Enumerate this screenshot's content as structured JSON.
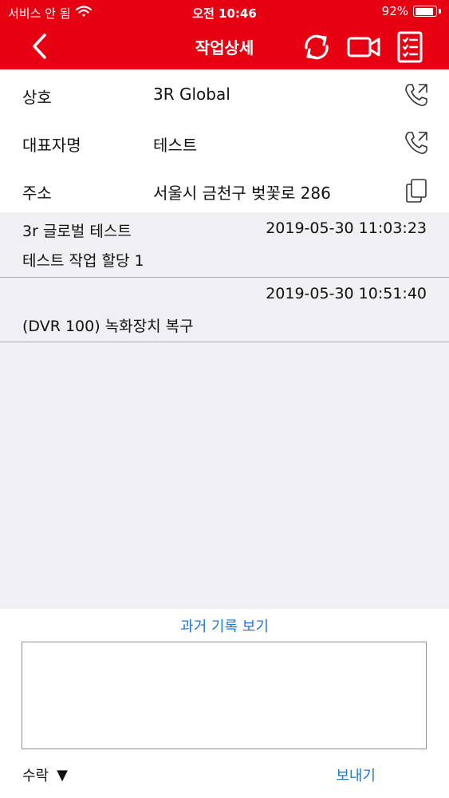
{
  "status_bar": {
    "carrier": "서비스 안 됨",
    "time": "오전 10:46",
    "battery_percent": "92%",
    "battery_level": 0.92
  },
  "nav": {
    "title": "작업상세"
  },
  "info": [
    {
      "label": "상호",
      "value": "3R Global",
      "icon": "phone-icon"
    },
    {
      "label": "대표자명",
      "value": "테스트",
      "icon": "phone-icon"
    },
    {
      "label": "주소",
      "value": "서울시 금천구 벚꽃로 286",
      "icon": "copy-icon"
    }
  ],
  "history": [
    {
      "author": "3r 글로벌  테스트",
      "timestamp": "2019-05-30 11:03:23",
      "message": "테스트 작업 할당 1"
    },
    {
      "author": "",
      "timestamp": "2019-05-30 10:51:40",
      "message": "(DVR 100) 녹화장치 복구"
    }
  ],
  "footer": {
    "past_records_link": "과거 기록 보기",
    "memo_value": "",
    "status_select": "수락",
    "select_arrow": "▼",
    "send_label": "보내기"
  },
  "colors": {
    "header": "#e60012",
    "list_bg": "#efeff4",
    "link": "#1f78d1"
  }
}
